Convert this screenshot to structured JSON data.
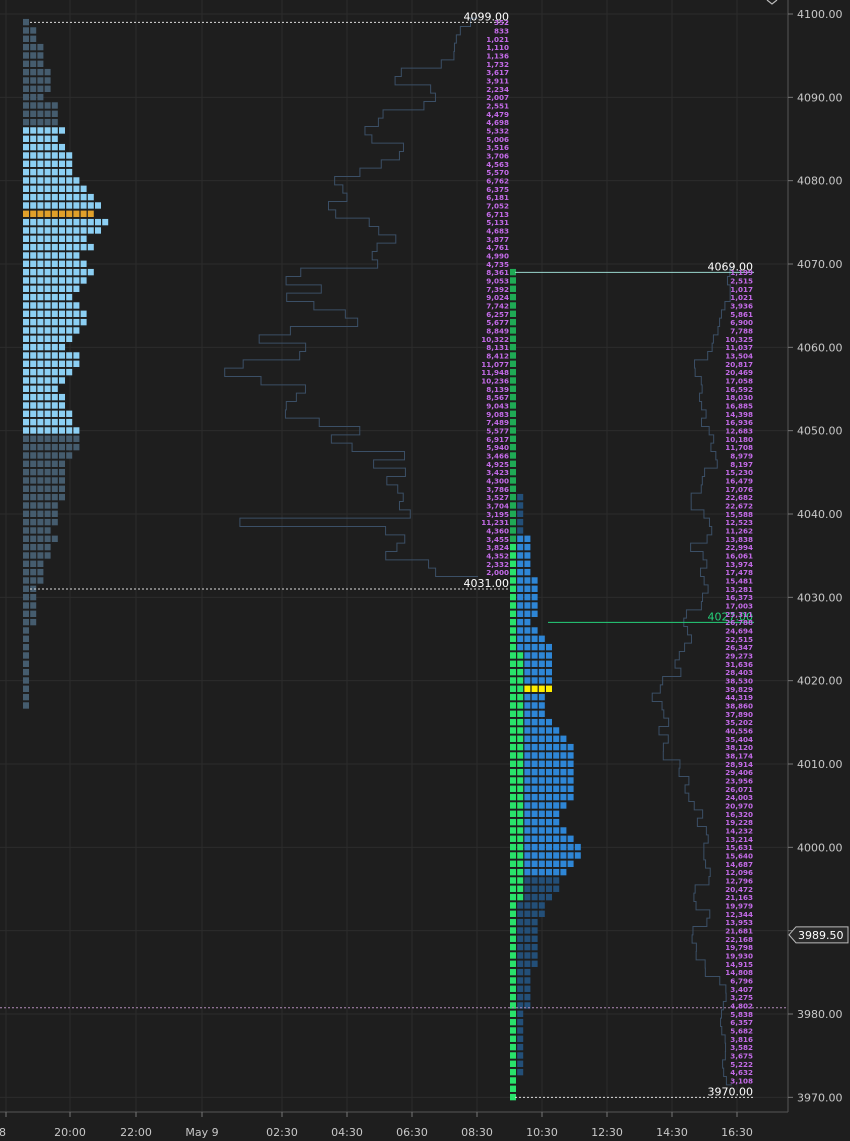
{
  "chart_data": {
    "type": "market-profile",
    "y_axis": {
      "ticks": [
        "4100.00",
        "4090.00",
        "4080.00",
        "4070.00",
        "4060.00",
        "4050.00",
        "4040.00",
        "4030.00",
        "4020.00",
        "4010.00",
        "4000.00",
        "3990.00",
        "3980.00",
        "3970.00"
      ],
      "tick_values": [
        4100,
        4090,
        4080,
        4070,
        4060,
        4050,
        4040,
        4030,
        4020,
        4010,
        4000,
        3990,
        3980,
        3970
      ],
      "range": [
        3968.8,
        4101.8
      ],
      "last_price": "3989.50"
    },
    "x_axis": {
      "ticks": [
        "8",
        "20:00",
        "22:00",
        "May 9",
        "02:30",
        "04:30",
        "06:30",
        "08:30",
        "10:30",
        "12:30",
        "14:30",
        "16:30"
      ]
    },
    "levels": {
      "prior_high": "4099.00",
      "prior_low": "4031.00",
      "session_high": "4069.00",
      "session_low": "3970.00",
      "current": "4027.00",
      "dotted_level": 3980.75
    },
    "prior_session": {
      "high": 4099,
      "low": 4031,
      "poc": 4076,
      "value_area": [
        4050,
        4086
      ],
      "tpo_counts": [
        1,
        2,
        2,
        3,
        3,
        3,
        4,
        4,
        4,
        3,
        5,
        5,
        5,
        6,
        5,
        6,
        7,
        7,
        7,
        8,
        9,
        10,
        11,
        10,
        12,
        11,
        9,
        10,
        8,
        9,
        10,
        9,
        8,
        7,
        8,
        9,
        9,
        8,
        7,
        6,
        8,
        8,
        7,
        6,
        5,
        6,
        6,
        7,
        7,
        8,
        8,
        8,
        7,
        6,
        6,
        6,
        6,
        6,
        5,
        5,
        5,
        4,
        5,
        4,
        4,
        3,
        3,
        3,
        2,
        2,
        2,
        2,
        2,
        1,
        1,
        1,
        1,
        1,
        1,
        1,
        1,
        1,
        1
      ]
    },
    "current_session": {
      "high": 4069,
      "low": 3970,
      "poc": 4019,
      "value_area": [
        3997,
        4037
      ],
      "tpo_counts": [
        1,
        1,
        1,
        1,
        1,
        1,
        1,
        1,
        1,
        1,
        1,
        1,
        1,
        1,
        1,
        1,
        1,
        1,
        1,
        1,
        1,
        1,
        1,
        1,
        1,
        1,
        1,
        2,
        2,
        2,
        2,
        2,
        3,
        3,
        3,
        3,
        3,
        4,
        4,
        4,
        4,
        4,
        3,
        4,
        5,
        6,
        6,
        6,
        6,
        6,
        6,
        5,
        5,
        5,
        6,
        7,
        8,
        9,
        9,
        9,
        9,
        9,
        9,
        9,
        8,
        7,
        7,
        8,
        9,
        10,
        10,
        9,
        8,
        7,
        7,
        6,
        5,
        5,
        4,
        4,
        4,
        4,
        4,
        4,
        3,
        3,
        3,
        3,
        3,
        2,
        2,
        2,
        2,
        2,
        2,
        2,
        2,
        1,
        1,
        1
      ],
      "green_tpo": [
        1,
        1,
        1,
        1,
        1,
        1,
        1,
        1,
        1,
        1,
        1,
        1,
        1,
        1,
        1,
        1,
        1,
        1,
        1,
        1,
        1,
        1,
        1,
        1,
        1,
        1,
        1,
        1,
        1,
        1,
        1,
        1,
        1,
        1,
        1,
        1,
        1,
        1,
        1,
        1,
        1,
        1,
        1,
        1,
        1,
        1,
        2,
        2,
        2,
        2,
        2,
        2,
        2,
        2,
        2,
        2,
        2,
        2,
        2,
        2,
        2,
        2,
        2,
        2,
        2,
        2,
        2,
        2,
        2,
        2,
        2,
        2,
        2,
        2,
        2,
        2,
        1,
        1,
        1,
        1,
        1,
        1,
        1,
        1,
        1,
        1,
        1,
        1,
        1,
        1,
        1,
        1,
        1,
        1,
        1,
        1,
        1,
        1,
        1,
        1
      ],
      "green_start": 4027
    },
    "prior_volume": {
      "top_price": 4099,
      "values": [
        "352",
        "833",
        "1,021",
        "1,110",
        "1,136",
        "1,732",
        "3,617",
        "3,911",
        "2,234",
        "2,007",
        "2,551",
        "4,479",
        "4,698",
        "5,332",
        "5,006",
        "3,516",
        "3,706",
        "4,563",
        "5,570",
        "6,762",
        "6,375",
        "6,181",
        "7,052",
        "6,713",
        "5,131",
        "4,683",
        "3,877",
        "4,761",
        "4,990",
        "4,735",
        "8,361",
        "9,053",
        "7,392",
        "9,024",
        "7,742",
        "6,257",
        "5,677",
        "8,849",
        "10,322",
        "8,131",
        "8,412",
        "11,077",
        "11,948",
        "10,236",
        "8,139",
        "8,567",
        "9,043",
        "9,083",
        "7,489",
        "5,577",
        "6,917",
        "5,940",
        "3,466",
        "4,925",
        "3,423",
        "4,300",
        "3,786",
        "3,527",
        "3,704",
        "3,195",
        "11,231",
        "4,360",
        "3,455",
        "3,824",
        "4,352",
        "2,332",
        "2,000"
      ]
    },
    "current_volume": {
      "top_price": 4069,
      "values": [
        "1,199",
        "2,515",
        "1,017",
        "1,021",
        "3,936",
        "5,861",
        "6,900",
        "7,788",
        "10,325",
        "11,037",
        "13,504",
        "20,817",
        "20,469",
        "17,058",
        "16,592",
        "18,030",
        "16,885",
        "14,398",
        "16,936",
        "12,683",
        "10,180",
        "11,708",
        "8,979",
        "8,197",
        "15,230",
        "16,479",
        "17,076",
        "22,682",
        "22,672",
        "15,588",
        "12,523",
        "11,262",
        "13,838",
        "22,994",
        "16,061",
        "13,974",
        "17,478",
        "15,481",
        "13,281",
        "16,373",
        "17,003",
        "25,311",
        "26,788",
        "24,694",
        "22,515",
        "26,347",
        "29,273",
        "31,636",
        "28,403",
        "38,530",
        "39,829",
        "44,319",
        "38,860",
        "37,890",
        "35,202",
        "40,556",
        "35,404",
        "38,120",
        "38,174",
        "28,914",
        "29,406",
        "23,956",
        "26,071",
        "24,003",
        "20,970",
        "16,320",
        "19,228",
        "14,232",
        "13,214",
        "15,631",
        "15,640",
        "14,687",
        "12,096",
        "12,796",
        "20,472",
        "21,163",
        "19,979",
        "12,344",
        "13,953",
        "21,681",
        "22,168",
        "19,798",
        "19,930",
        "14,915",
        "14,808",
        "6,796",
        "3,407",
        "3,275",
        "4,802",
        "5,838",
        "6,357",
        "5,682",
        "3,816",
        "3,582",
        "3,675",
        "5,222",
        "4,632",
        "3,108"
      ]
    }
  },
  "colors": {
    "background": "#1e1e1e",
    "grid": "#2c2c2c",
    "prior_value_area": "#8ccff3",
    "prior_outside": "#455c6e",
    "prior_poc": "#e0a02a",
    "current_value_area": "#2e86d6",
    "current_outside": "#234f78",
    "current_poc": "#ffee00",
    "green_tpo": "#1faa55",
    "green_highlight": "#29e36b",
    "volume_text": "#c46be8",
    "volume_outline": "#3b4f66",
    "axis_text": "#c8c8c8",
    "level_line": "#9ad8cf",
    "current_line": "#25d07a",
    "dotted_line": "#b08ab8"
  }
}
